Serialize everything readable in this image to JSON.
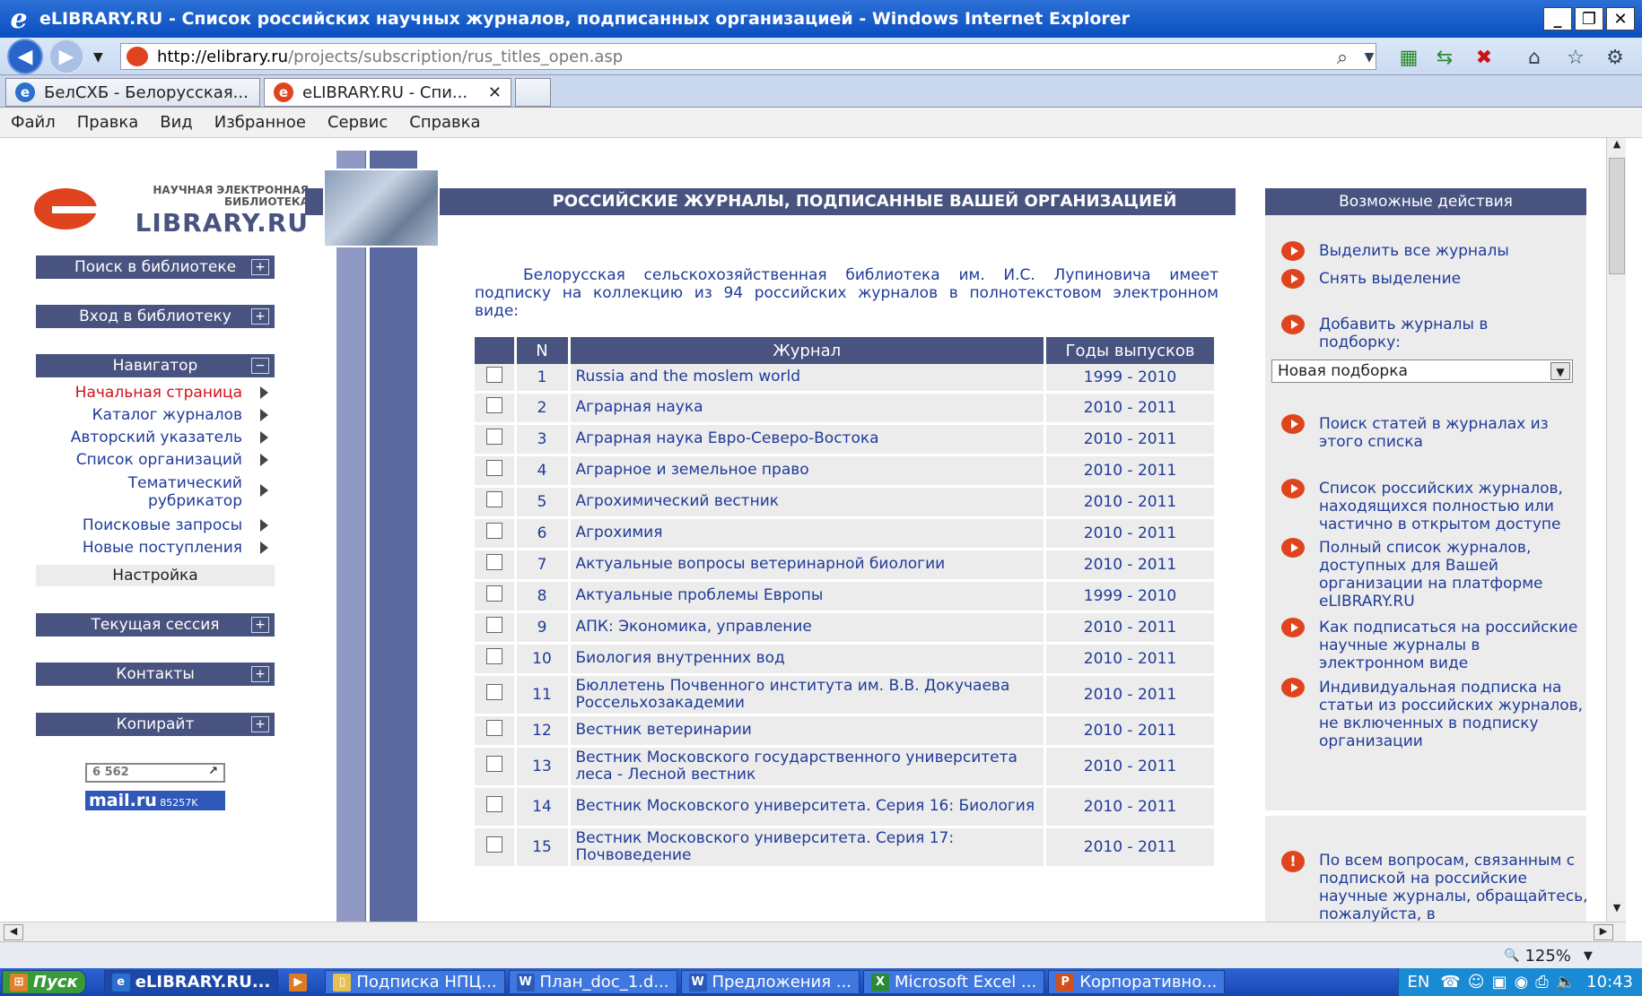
{
  "window": {
    "title": "eLIBRARY.RU - Список российских научных журналов, подписанных организацией - Windows Internet Explorer",
    "address_domain": "http://elibrary.ru",
    "address_path": "/projects/subscription/rus_titles_open.asp"
  },
  "tabs": [
    {
      "label": "БелСХБ - Белорусская..."
    },
    {
      "label": "eLIBRARY.RU - Спи..."
    }
  ],
  "menu": [
    "Файл",
    "Правка",
    "Вид",
    "Избранное",
    "Сервис",
    "Справка"
  ],
  "logo": {
    "line1": "НАУЧНАЯ ЭЛЕКТРОННАЯ",
    "line2": "БИБЛИОТЕКА",
    "brand": "LIBRARY.RU"
  },
  "sidebar": {
    "search": "Поиск в библиотеке",
    "login": "Вход в библиотеку",
    "navigator": "Навигатор",
    "nav_items": [
      "Начальная страница",
      "Каталог журналов",
      "Авторский указатель",
      "Список организаций",
      "Тематический",
      "рубрикатор",
      "Поисковые запросы",
      "Новые поступления"
    ],
    "settings": "Настройка",
    "session": "Текущая сессия",
    "contacts": "Контакты",
    "copyright": "Копирайт",
    "counter1": "6 562",
    "counter2_brand": "mail.ru",
    "counter2_value": "85257K"
  },
  "main": {
    "header": "РОССИЙСКИЕ ЖУРНАЛЫ, ПОДПИСАННЫЕ ВАШЕЙ ОРГАНИЗАЦИЕЙ",
    "intro_line1": "Белорусская сельскохозяйственная библиотека им. И.С. Лупиновича имеет",
    "intro_line2": "подписку на коллекцию из 94 российских журналов в полнотекстовом электронном",
    "intro_line3": "виде:",
    "columns": [
      "N",
      "Журнал",
      "Годы выпусков"
    ],
    "rows": [
      {
        "n": "1",
        "journal": "Russia and the moslem world",
        "years": "1999 - 2010"
      },
      {
        "n": "2",
        "journal": "Аграрная наука",
        "years": "2010 - 2011"
      },
      {
        "n": "3",
        "journal": "Аграрная наука Евро-Северо-Востока",
        "years": "2010 - 2011"
      },
      {
        "n": "4",
        "journal": "Аграрное и земельное право",
        "years": "2010 - 2011"
      },
      {
        "n": "5",
        "journal": "Агрохимический вестник",
        "years": "2010 - 2011"
      },
      {
        "n": "6",
        "journal": "Агрохимия",
        "years": "2010 - 2011"
      },
      {
        "n": "7",
        "journal": "Актуальные вопросы ветеринарной биологии",
        "years": "2010 - 2011"
      },
      {
        "n": "8",
        "journal": "Актуальные проблемы Европы",
        "years": "1999 - 2010"
      },
      {
        "n": "9",
        "journal": "АПК: Экономика, управление",
        "years": "2010 - 2011"
      },
      {
        "n": "10",
        "journal": "Биология внутренних вод",
        "years": "2010 - 2011"
      },
      {
        "n": "11",
        "journal": "Бюллетень Почвенного института им. В.В. Докучаева Россельхозакадемии",
        "years": "2010 - 2011"
      },
      {
        "n": "12",
        "journal": "Вестник ветеринарии",
        "years": "2010 - 2011"
      },
      {
        "n": "13",
        "journal": "Вестник Московского государственного университета леса - Лесной вестник",
        "years": "2010 - 2011"
      },
      {
        "n": "14",
        "journal": "Вестник Московского университета. Серия 16: Биология",
        "years": "2010 - 2011"
      },
      {
        "n": "15",
        "journal": "Вестник Московского университета. Серия 17: Почвоведение",
        "years": "2010 - 2011"
      }
    ]
  },
  "actions": {
    "header": "Возможные действия",
    "select_all": "Выделить все журналы",
    "deselect": "Снять выделение",
    "add_to": "Добавить журналы в подборку:",
    "select_value": "Новая подборка",
    "search_articles": "Поиск статей в журналах из этого списка",
    "open_access": "Список российских журналов, находящихся полностью или частично в открытом доступе",
    "full_list": "Полный список журналов, доступных для Вашей организации на платформе eLIBRARY.RU",
    "how_subscribe": "Как подписаться на российские научные журналы в электронном виде",
    "individual": "Индивидуальная подписка на статьи из российских журналов, не включенных в подписку организации",
    "info": "По всем вопросам, связанным с подпиской на российские научные журналы, обращайтесь, пожалуйста, в"
  },
  "statusbar": {
    "zoom": "125%"
  },
  "taskbar": {
    "start": "Пуск",
    "items": [
      "eLIBRARY.RU...",
      "Подписка НПЦ...",
      "План_doc_1.d...",
      "Предложения ...",
      "Microsoft Excel ...",
      "Корпоративно..."
    ],
    "lang": "EN",
    "clock": "10:43"
  },
  "colors": {
    "nav_blue": "#48537f",
    "link_blue": "#1f3b99",
    "accent_red": "#e0441f",
    "titlebar": "#0a4fc0"
  }
}
